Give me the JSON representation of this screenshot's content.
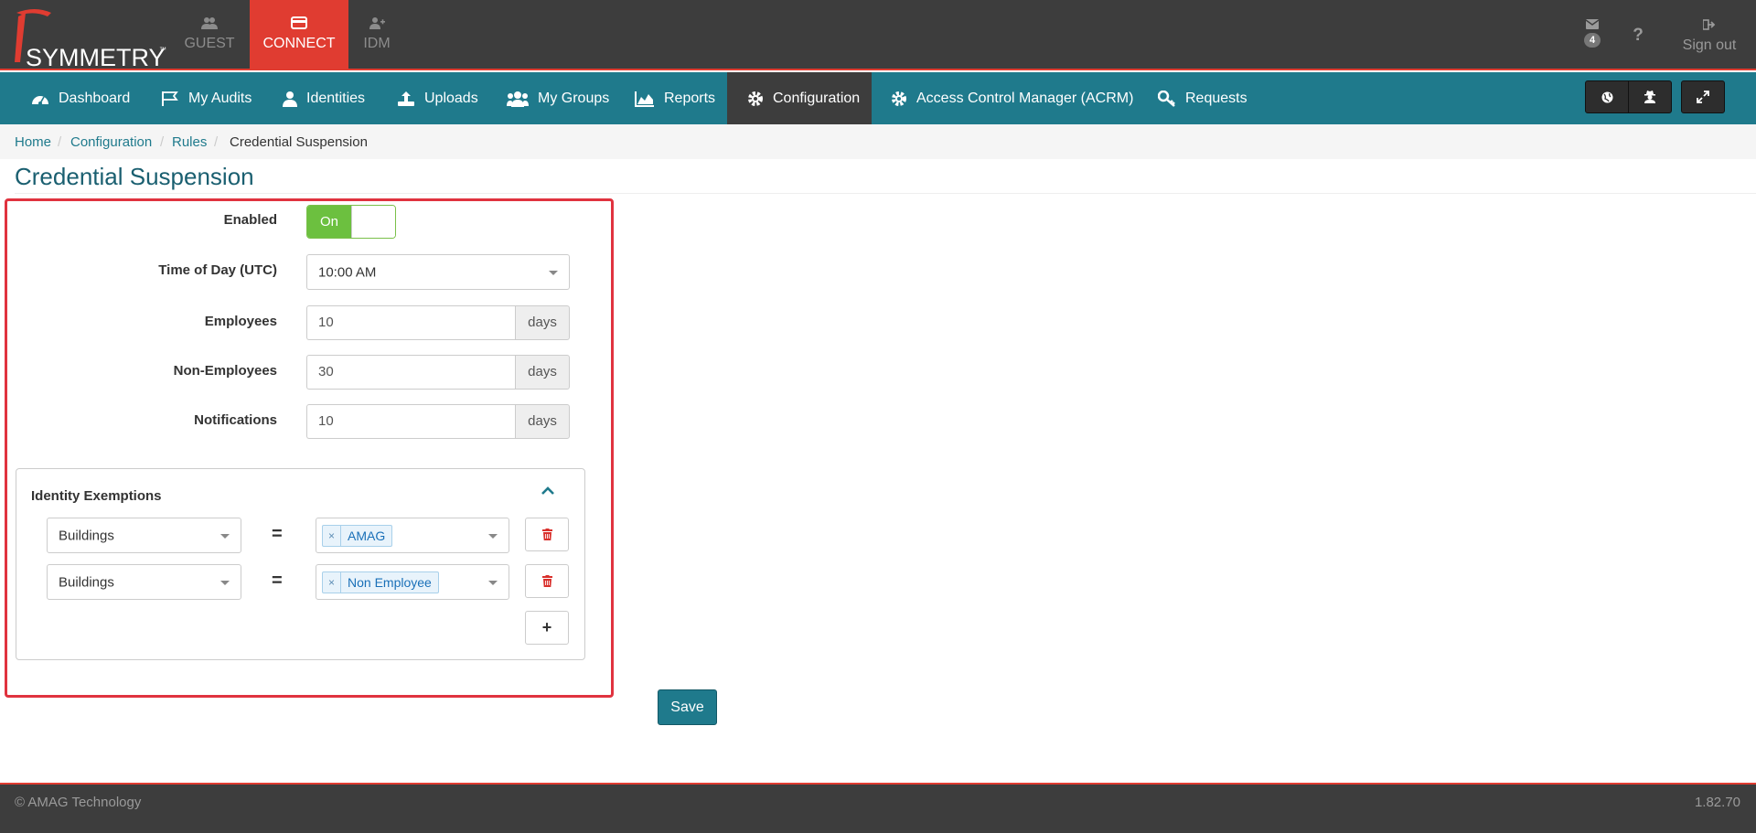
{
  "brand": {
    "name": "SYMMETRY",
    "tm": "™"
  },
  "app_tabs": [
    {
      "label": "GUEST",
      "icon": "users-icon"
    },
    {
      "label": "CONNECT",
      "icon": "card-icon",
      "active": true
    },
    {
      "label": "IDM",
      "icon": "user-plus-icon"
    }
  ],
  "top_right": {
    "messages_count": "4",
    "help_label": "?",
    "signout_label": "Sign out"
  },
  "nav": {
    "items": [
      {
        "label": "Dashboard",
        "icon": "dashboard-icon"
      },
      {
        "label": "My Audits",
        "icon": "flag-icon"
      },
      {
        "label": "Identities",
        "icon": "user-icon"
      },
      {
        "label": "Uploads",
        "icon": "upload-icon"
      },
      {
        "label": "My Groups",
        "icon": "group-icon"
      },
      {
        "label": "Reports",
        "icon": "area-chart-icon"
      },
      {
        "label": "Configuration",
        "icon": "gear-icon",
        "active": true
      },
      {
        "label": "Access Control Manager (ACRM)",
        "icon": "gear-icon"
      },
      {
        "label": "Requests",
        "icon": "key-icon"
      }
    ],
    "right_buttons": [
      "globe-icon",
      "user-secret-icon",
      "expand-icon"
    ]
  },
  "breadcrumb": [
    "Home",
    "Configuration",
    "Rules",
    "Credential Suspension"
  ],
  "page_title": "Credential Suspension",
  "form": {
    "enabled_label": "Enabled",
    "enabled_value": "On",
    "time_label": "Time of Day (UTC)",
    "time_value": "10:00 AM",
    "employees_label": "Employees",
    "employees_value": "10",
    "non_employees_label": "Non-Employees",
    "non_employees_value": "30",
    "notifications_label": "Notifications",
    "notifications_value": "10",
    "unit": "days"
  },
  "exemptions": {
    "title": "Identity Exemptions",
    "operator": "=",
    "rows": [
      {
        "field": "Buildings",
        "tag": "AMAG"
      },
      {
        "field": "Buildings",
        "tag": "Non Employee"
      }
    ],
    "tag_remove": "×",
    "add_label": "+"
  },
  "save_label": "Save",
  "footer": {
    "copyright": "© AMAG Technology",
    "version": "1.82.70"
  },
  "colors": {
    "accent_red": "#e03c31",
    "nav_teal": "#1f7a8c",
    "toggle_green": "#6cc03f",
    "dark_bg": "#3d3d3d"
  }
}
